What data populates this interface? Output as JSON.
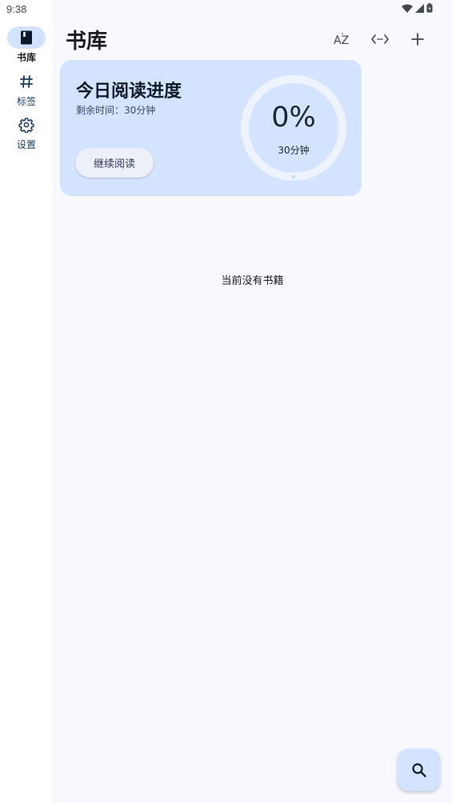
{
  "status_bar": {
    "time": "9:38"
  },
  "nav": {
    "items": [
      {
        "label": "书库",
        "icon": "book-icon",
        "active": true
      },
      {
        "label": "标签",
        "icon": "hash-icon",
        "active": false
      },
      {
        "label": "设置",
        "icon": "gear-icon",
        "active": false
      }
    ]
  },
  "header": {
    "title": "书库",
    "actions": [
      {
        "icon": "sort-az-icon",
        "text": "AZ"
      },
      {
        "icon": "code-icon"
      },
      {
        "icon": "add-icon"
      }
    ]
  },
  "progress_card": {
    "title": "今日阅读进度",
    "remaining": "剩余时间：30分钟",
    "continue_label": "继续阅读",
    "percent_text": "0%",
    "percent_value": 0,
    "goal_text": "30分钟"
  },
  "empty_state": {
    "message": "当前没有书籍"
  },
  "fab": {
    "icon": "search-icon"
  },
  "colors": {
    "accent": "#d4e3ff",
    "background": "#f7f9ff",
    "rail": "#ffffff",
    "text": "#191c20"
  }
}
